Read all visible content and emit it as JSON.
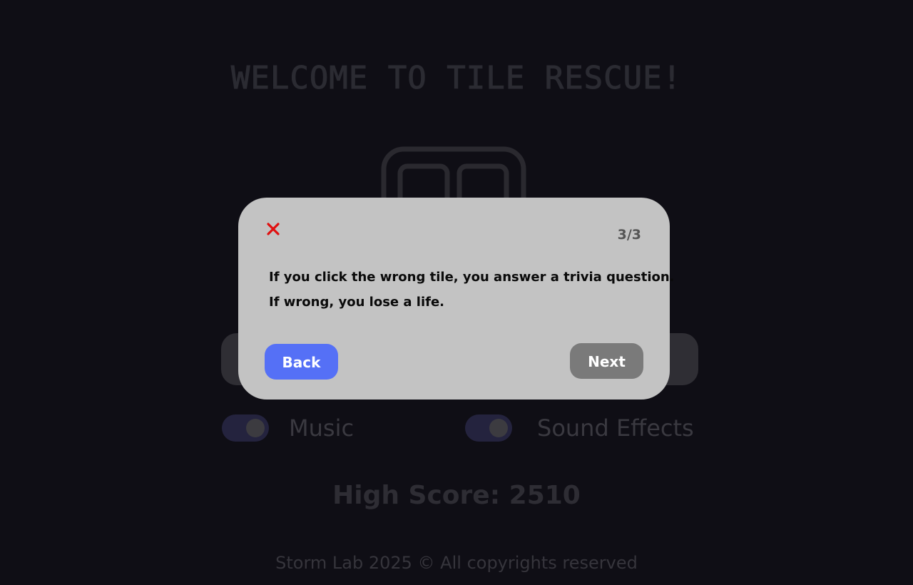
{
  "app": {
    "title": "WELCOME TO TILE RESCUE!"
  },
  "settings": {
    "music_label": "Music",
    "music_enabled": true,
    "sound_effects_label": "Sound Effects",
    "sound_effects_enabled": true
  },
  "stats": {
    "high_score_text": "High Score: 2510"
  },
  "footer": {
    "text": "Storm Lab 2025 © All copyrights reserved"
  },
  "tutorial_modal": {
    "close_icon": "close-x-icon",
    "step_indicator": "3/3",
    "lines": [
      "If you click the wrong tile, you answer a trivia question.",
      "If wrong, you lose a life."
    ],
    "back_label": "Back",
    "next_label": "Next"
  },
  "colors": {
    "background": "#0f0e15",
    "modal": "#c3c3c3",
    "close_icon": "#e01010",
    "back_button": "#5570f6",
    "next_button": "#7a7a7a",
    "toggle_track": "#24233e"
  }
}
